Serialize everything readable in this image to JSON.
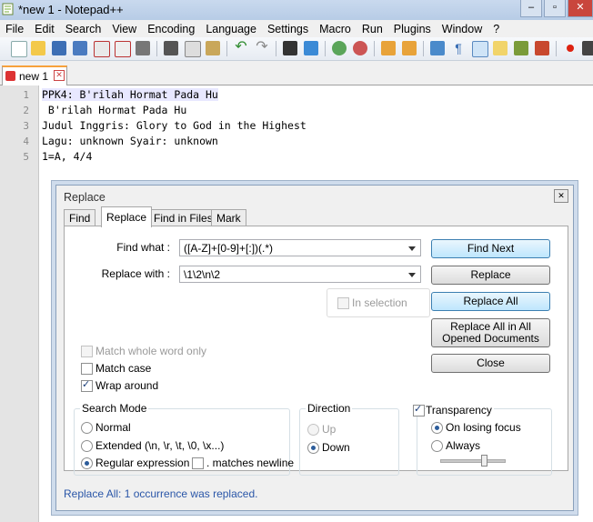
{
  "window": {
    "title": "*new  1 - Notepad++"
  },
  "menu": [
    "File",
    "Edit",
    "Search",
    "View",
    "Encoding",
    "Language",
    "Settings",
    "Macro",
    "Run",
    "Plugins",
    "Window",
    "?"
  ],
  "tab": {
    "label": "new  1"
  },
  "editor": {
    "lines": [
      {
        "num": "1",
        "text": "PPK4: B'rilah Hormat Pada Hu"
      },
      {
        "num": "2",
        "text": " B'rilah Hormat Pada Hu"
      },
      {
        "num": "3",
        "text": "Judul Inggris: Glory to God in the Highest"
      },
      {
        "num": "4",
        "text": "Lagu: unknown Syair: unknown"
      },
      {
        "num": "5",
        "text": "1=A, 4/4"
      }
    ]
  },
  "dialog": {
    "title": "Replace",
    "tabs": [
      "Find",
      "Replace",
      "Find in Files",
      "Mark"
    ],
    "find_label": "Find what :",
    "find_value": "([A-Z]+[0-9]+[:])(.*)",
    "replace_label": "Replace with :",
    "replace_value": "\\1\\2\\n\\2",
    "in_selection": "In selection",
    "buttons": {
      "find_next": "Find Next",
      "replace": "Replace",
      "replace_all": "Replace All",
      "replace_all_opened": "Replace All in All Opened Documents",
      "close": "Close"
    },
    "options": {
      "match_whole": "Match whole word only",
      "match_case": "Match case",
      "wrap_around": "Wrap around"
    },
    "search_mode": {
      "title": "Search Mode",
      "normal": "Normal",
      "extended": "Extended (\\n, \\r, \\t, \\0, \\x...)",
      "regex": "Regular expression",
      "matches_newline": ". matches newline"
    },
    "direction": {
      "title": "Direction",
      "up": "Up",
      "down": "Down"
    },
    "transparency": {
      "title": "Transparency",
      "on_losing_focus": "On losing focus",
      "always": "Always"
    },
    "status": "Replace All: 1 occurrence was replaced."
  }
}
